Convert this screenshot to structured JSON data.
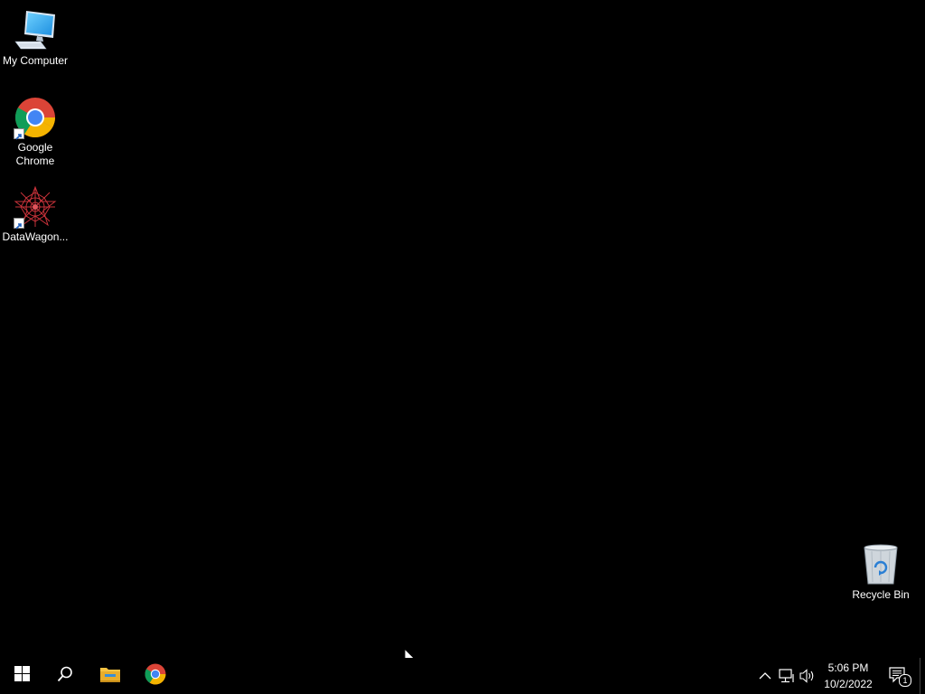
{
  "desktop": {
    "icons": [
      {
        "label": "My Computer",
        "icon": "computer-icon"
      },
      {
        "label": "Google\nChrome",
        "icon": "chrome-icon"
      },
      {
        "label": "DataWagon...",
        "icon": "datawagon-icon"
      },
      {
        "label": "Recycle Bin",
        "icon": "recycle-bin-icon"
      }
    ]
  },
  "taskbar": {
    "start_icon": "windows-start-icon",
    "search_icon": "search-icon",
    "pinned": [
      {
        "name": "File Explorer",
        "icon": "file-explorer-icon"
      },
      {
        "name": "Google Chrome",
        "icon": "chrome-icon"
      }
    ],
    "tray": {
      "icons": [
        "chevron-up-icon",
        "network-icon",
        "volume-icon"
      ]
    },
    "clock": {
      "time": "5:06 PM",
      "date": "10/2/2022"
    },
    "notifications": {
      "count": "1",
      "icon": "action-center-icon"
    }
  },
  "colors": {
    "background": "#000000",
    "text": "#ffffff",
    "chrome_red": "#db4437",
    "chrome_green": "#0f9d58",
    "chrome_yellow": "#f4b400",
    "chrome_blue": "#4285f4",
    "folder_yellow": "#f6c342"
  }
}
